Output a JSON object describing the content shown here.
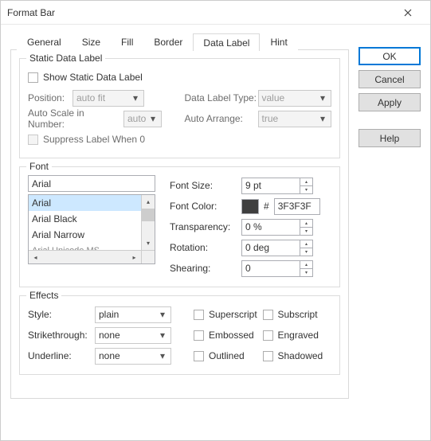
{
  "window": {
    "title": "Format Bar"
  },
  "tabs": {
    "items": [
      "General",
      "Size",
      "Fill",
      "Border",
      "Data Label",
      "Hint"
    ],
    "active": 4
  },
  "buttons": {
    "ok": "OK",
    "cancel": "Cancel",
    "apply": "Apply",
    "help": "Help"
  },
  "static": {
    "group": "Static Data Label",
    "show": "Show Static Data Label",
    "position_lbl": "Position:",
    "position_val": "auto fit",
    "type_lbl": "Data Label Type:",
    "type_val": "value",
    "autoscale_lbl": "Auto Scale in Number:",
    "autoscale_val": "auto",
    "autoarrange_lbl": "Auto Arrange:",
    "autoarrange_val": "true",
    "suppress": "Suppress Label When 0"
  },
  "font": {
    "group": "Font",
    "family_value": "Arial",
    "list": [
      "Arial",
      "Arial Black",
      "Arial Narrow",
      "Arial Unicode MS"
    ],
    "selected": 0,
    "size_lbl": "Font Size:",
    "size_val": "9 pt",
    "color_lbl": "Font Color:",
    "color_hex": "3F3F3F",
    "transparency_lbl": "Transparency:",
    "transparency_val": "0 %",
    "rotation_lbl": "Rotation:",
    "rotation_val": "0 deg",
    "shearing_lbl": "Shearing:",
    "shearing_val": "0"
  },
  "effects": {
    "group": "Effects",
    "style_lbl": "Style:",
    "style_val": "plain",
    "strike_lbl": "Strikethrough:",
    "strike_val": "none",
    "underline_lbl": "Underline:",
    "underline_val": "none",
    "superscript": "Superscript",
    "subscript": "Subscript",
    "embossed": "Embossed",
    "engraved": "Engraved",
    "outlined": "Outlined",
    "shadowed": "Shadowed"
  }
}
